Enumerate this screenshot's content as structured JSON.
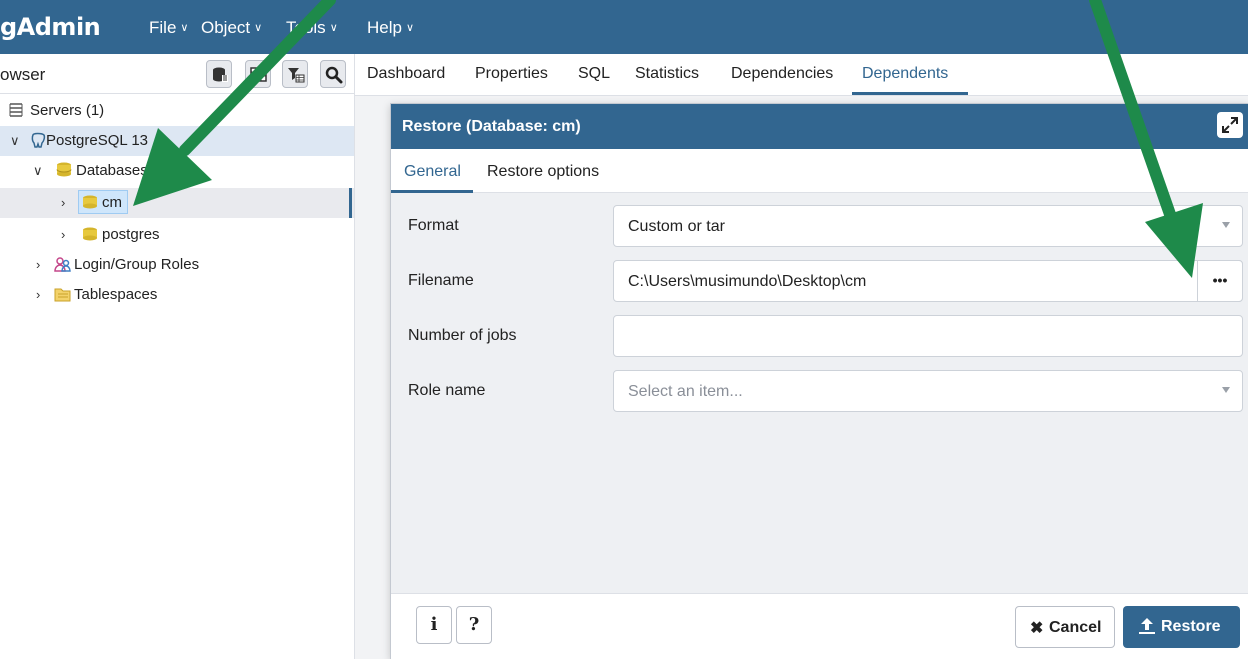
{
  "menubar": {
    "logo": "gAdmin",
    "items": [
      "File",
      "Object",
      "Tools",
      "Help"
    ]
  },
  "browser": {
    "title": "owser",
    "tree": {
      "servers": "Servers (1)",
      "server": "PostgreSQL 13",
      "databases": "Databases",
      "db_cm": "cm",
      "db_postgres": "postgres",
      "login_roles": "Login/Group Roles",
      "tablespaces": "Tablespaces"
    }
  },
  "tabs": [
    "Dashboard",
    "Properties",
    "SQL",
    "Statistics",
    "Dependencies",
    "Dependents"
  ],
  "active_tab": "Dependents",
  "dialog": {
    "title": "Restore (Database: cm)",
    "tabs": [
      "General",
      "Restore options"
    ],
    "fields": {
      "format_label": "Format",
      "format_value": "Custom or tar",
      "filename_label": "Filename",
      "filename_value": "C:\\Users\\musimundo\\Desktop\\cm",
      "jobs_label": "Number of jobs",
      "jobs_value": "",
      "role_label": "Role name",
      "role_placeholder": "Select an item..."
    },
    "buttons": {
      "info": "i",
      "help": "?",
      "cancel": "Cancel",
      "restore": "Restore",
      "browse": "•••"
    }
  },
  "colors": {
    "brand": "#326690",
    "annotation_arrow": "#1e8a4a"
  }
}
